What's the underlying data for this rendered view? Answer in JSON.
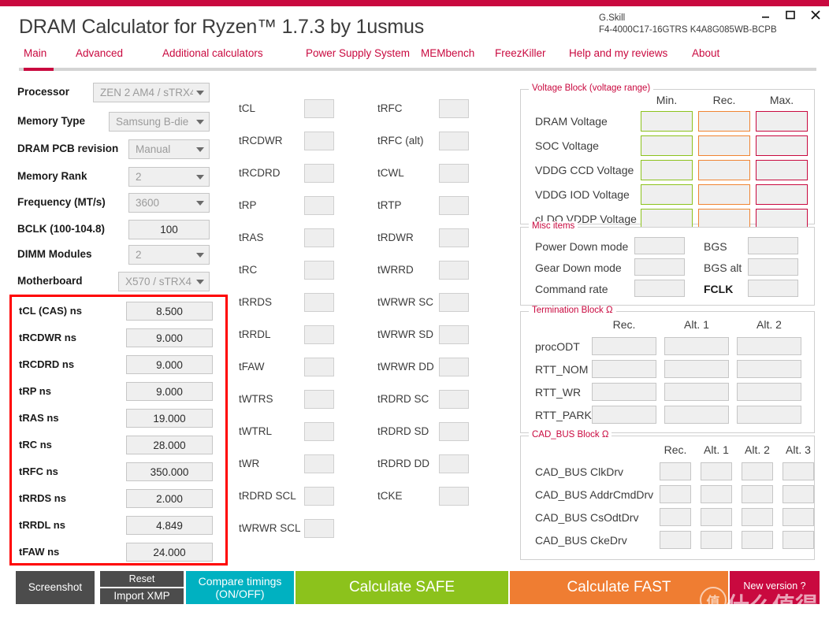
{
  "window": {
    "title": "DRAM Calculator for Ryzen™ 1.7.3 by 1usmus",
    "minimize_label": "_",
    "maximize_label": "maximize-icon",
    "close_label": "✕",
    "accent_color": "#c9093f"
  },
  "kit": {
    "brand": "G.Skill",
    "part": "F4-4000C17-16GTRS K4A8G085WB-BCPB"
  },
  "tabs": [
    {
      "label": "Main",
      "active": true
    },
    {
      "label": "Advanced",
      "active": false
    },
    {
      "label": "Additional calculators",
      "active": false
    },
    {
      "label": "Power Supply System",
      "active": false
    },
    {
      "label": "MEMbench",
      "active": false
    },
    {
      "label": "FreezKiller",
      "active": false
    },
    {
      "label": "Help and my reviews",
      "active": false
    },
    {
      "label": "About",
      "active": false
    }
  ],
  "settings": [
    {
      "label": "Processor",
      "value": "ZEN 2 AM4 / sTRX4",
      "type": "combo"
    },
    {
      "label": "Memory Type",
      "value": "Samsung B-die",
      "type": "combo"
    },
    {
      "label": "DRAM PCB revision",
      "value": "Manual",
      "type": "combo"
    },
    {
      "label": "Memory Rank",
      "value": "2",
      "type": "combo"
    },
    {
      "label": "Frequency (MT/s)",
      "value": "3600",
      "type": "combo"
    },
    {
      "label": "BCLK (100-104.8)",
      "value": "100",
      "type": "number"
    },
    {
      "label": "DIMM Modules",
      "value": "2",
      "type": "combo"
    },
    {
      "label": "Motherboard",
      "value": "X570 / sTRX4",
      "type": "combo"
    }
  ],
  "ns_timings": {
    "highlight_color": "#ff0000",
    "rows": [
      {
        "label": "tCL (CAS) ns",
        "value": "8.500"
      },
      {
        "label": "tRCDWR ns",
        "value": "9.000"
      },
      {
        "label": "tRCDRD ns",
        "value": "9.000"
      },
      {
        "label": "tRP ns",
        "value": "9.000"
      },
      {
        "label": "tRAS ns",
        "value": "19.000"
      },
      {
        "label": "tRC ns",
        "value": "28.000"
      },
      {
        "label": "tRFC ns",
        "value": "350.000"
      },
      {
        "label": "tRRDS ns",
        "value": "2.000"
      },
      {
        "label": "tRRDL ns",
        "value": "4.849"
      },
      {
        "label": "tFAW ns",
        "value": "24.000"
      }
    ]
  },
  "timings_col1": [
    {
      "label": "tCL",
      "value": ""
    },
    {
      "label": "tRCDWR",
      "value": ""
    },
    {
      "label": "tRCDRD",
      "value": ""
    },
    {
      "label": "tRP",
      "value": ""
    },
    {
      "label": "tRAS",
      "value": ""
    },
    {
      "label": "tRC",
      "value": ""
    },
    {
      "label": "tRRDS",
      "value": ""
    },
    {
      "label": "tRRDL",
      "value": ""
    },
    {
      "label": "tFAW",
      "value": ""
    },
    {
      "label": "tWTRS",
      "value": ""
    },
    {
      "label": "tWTRL",
      "value": ""
    },
    {
      "label": "tWR",
      "value": ""
    },
    {
      "label": "tRDRD SCL",
      "value": ""
    },
    {
      "label": "tWRWR SCL",
      "value": ""
    }
  ],
  "timings_col2": [
    {
      "label": "tRFC",
      "value": ""
    },
    {
      "label": "tRFC (alt)",
      "value": ""
    },
    {
      "label": "tCWL",
      "value": ""
    },
    {
      "label": "tRTP",
      "value": ""
    },
    {
      "label": "tRDWR",
      "value": ""
    },
    {
      "label": "tWRRD",
      "value": ""
    },
    {
      "label": "tWRWR SC",
      "value": ""
    },
    {
      "label": "tWRWR SD",
      "value": ""
    },
    {
      "label": "tWRWR DD",
      "value": ""
    },
    {
      "label": "tRDRD SC",
      "value": ""
    },
    {
      "label": "tRDRD SD",
      "value": ""
    },
    {
      "label": "tRDRD DD",
      "value": ""
    },
    {
      "label": "tCKE",
      "value": ""
    }
  ],
  "voltage_block": {
    "title": "Voltage Block (voltage range)",
    "columns": [
      "Min.",
      "Rec.",
      "Max."
    ],
    "column_colors": [
      "#8cc21c",
      "#f08432",
      "#c9093f"
    ],
    "rows": [
      {
        "label": "DRAM Voltage",
        "min": "",
        "rec": "",
        "max": ""
      },
      {
        "label": "SOC Voltage",
        "min": "",
        "rec": "",
        "max": ""
      },
      {
        "label": "VDDG  CCD Voltage",
        "min": "",
        "rec": "",
        "max": ""
      },
      {
        "label": "VDDG  IOD Voltage",
        "min": "",
        "rec": "",
        "max": ""
      },
      {
        "label": "cLDO VDDP Voltage",
        "min": "",
        "rec": "",
        "max": ""
      }
    ]
  },
  "misc_items": {
    "title": "Misc items",
    "left_rows": [
      {
        "label": "Power Down mode",
        "value": ""
      },
      {
        "label": "Gear Down mode",
        "value": ""
      },
      {
        "label": "Command rate",
        "value": ""
      }
    ],
    "right_rows": [
      {
        "label": "BGS",
        "value": "",
        "bold": false
      },
      {
        "label": "BGS alt",
        "value": "",
        "bold": false
      },
      {
        "label": "FCLK",
        "value": "",
        "bold": true
      }
    ]
  },
  "termination_block": {
    "title": "Termination Block Ω",
    "columns": [
      "Rec.",
      "Alt. 1",
      "Alt. 2"
    ],
    "rows": [
      {
        "label": "procODT",
        "rec": "",
        "alt1": "",
        "alt2": ""
      },
      {
        "label": "RTT_NOM",
        "rec": "",
        "alt1": "",
        "alt2": ""
      },
      {
        "label": "RTT_WR",
        "rec": "",
        "alt1": "",
        "alt2": ""
      },
      {
        "label": "RTT_PARK",
        "rec": "",
        "alt1": "",
        "alt2": ""
      }
    ]
  },
  "cad_bus_block": {
    "title": "CAD_BUS Block Ω",
    "columns": [
      "Rec.",
      "Alt. 1",
      "Alt. 2",
      "Alt. 3"
    ],
    "rows": [
      {
        "label": "CAD_BUS ClkDrv",
        "rec": "",
        "alt1": "",
        "alt2": "",
        "alt3": ""
      },
      {
        "label": "CAD_BUS AddrCmdDrv",
        "rec": "",
        "alt1": "",
        "alt2": "",
        "alt3": ""
      },
      {
        "label": "CAD_BUS CsOdtDrv",
        "rec": "",
        "alt1": "",
        "alt2": "",
        "alt3": ""
      },
      {
        "label": "CAD_BUS CkeDrv",
        "rec": "",
        "alt1": "",
        "alt2": "",
        "alt3": ""
      }
    ]
  },
  "buttons": {
    "screenshot": "Screenshot",
    "reset": "Reset",
    "import_xmp": "Import XMP",
    "compare_line1": "Compare timings",
    "compare_line2": "(ON/OFF)",
    "calculate_safe": "Calculate SAFE",
    "calculate_fast": "Calculate FAST",
    "new_version": "New version ?"
  },
  "watermark": {
    "mark": "值",
    "text": "什么值得买"
  }
}
